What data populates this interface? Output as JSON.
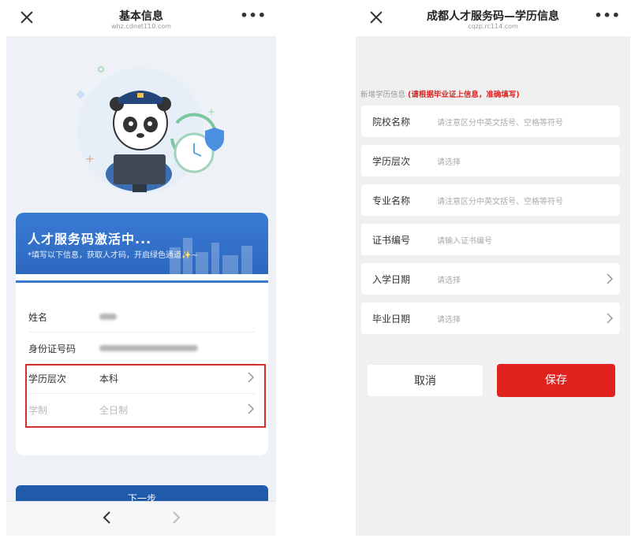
{
  "left": {
    "title": "基本信息",
    "url": "whz.cdnet110.com",
    "banner": {
      "heading": "人才服务码激活中...",
      "subheading": "*填写以下信息，获取人才码，开启绿色通道✨~"
    },
    "fields": [
      {
        "label": "姓名",
        "value": ""
      },
      {
        "label": "身份证号码",
        "value": ""
      },
      {
        "label": "学历层次",
        "value": "本科"
      },
      {
        "label": "学制",
        "value": "全日制"
      }
    ],
    "next_button": "下一步"
  },
  "right": {
    "title": "成都人才服务码—学历信息",
    "url": "cqzp.rc114.com",
    "notice_prefix": "新增学历信息",
    "notice_highlight": "(请根据毕业证上信息，准确填写)",
    "fields": [
      {
        "label": "院校名称",
        "placeholder": "请注意区分中英文括号、空格等符号"
      },
      {
        "label": "学历层次",
        "placeholder": "请选择"
      },
      {
        "label": "专业名称",
        "placeholder": "请注意区分中英文括号、空格等符号"
      },
      {
        "label": "证书编号",
        "placeholder": "请输入证书编号"
      },
      {
        "label": "入学日期",
        "placeholder": "请选择"
      },
      {
        "label": "毕业日期",
        "placeholder": "请选择"
      }
    ],
    "cancel_button": "取消",
    "save_button": "保存"
  },
  "colors": {
    "brand_blue": "#3a7bd5",
    "highlight_red": "#d42e2e",
    "save_red": "#e1231f"
  }
}
